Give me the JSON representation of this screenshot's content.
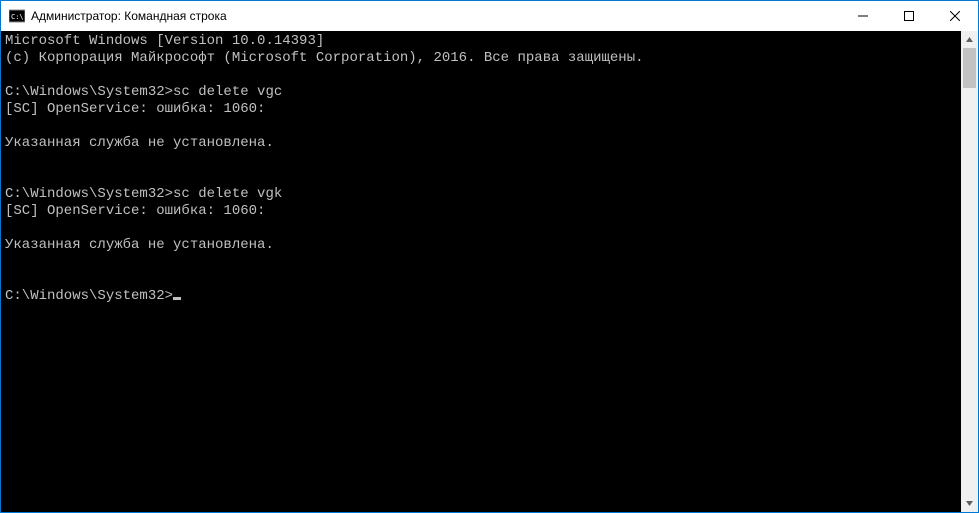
{
  "window": {
    "title": "Администратор: Командная строка"
  },
  "terminal": {
    "line0": "Microsoft Windows [Version 10.0.14393]",
    "line1": "(c) Корпорация Майкрософт (Microsoft Corporation), 2016. Все права защищены.",
    "line2": "",
    "line3": "C:\\Windows\\System32>sc delete vgc",
    "line4": "[SC] OpenService: ошибка: 1060:",
    "line5": "",
    "line6": "Указанная служба не установлена.",
    "line7": "",
    "line8": "",
    "line9": "C:\\Windows\\System32>sc delete vgk",
    "line10": "[SC] OpenService: ошибка: 1060:",
    "line11": "",
    "line12": "Указанная служба не установлена.",
    "line13": "",
    "line14": "",
    "prompt": "C:\\Windows\\System32>"
  }
}
